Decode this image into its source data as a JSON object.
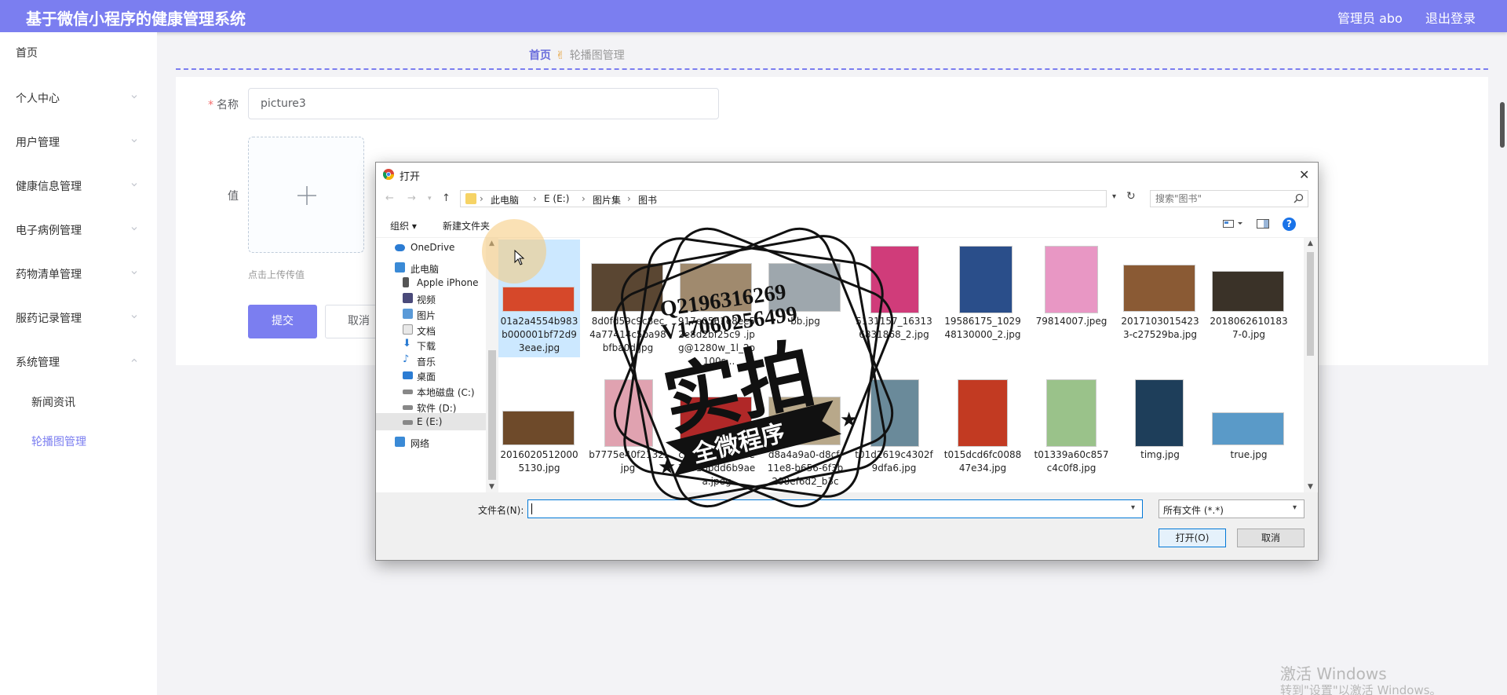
{
  "header": {
    "title": "基于微信小程序的健康管理系统",
    "user": "管理员 abo",
    "logout": "退出登录",
    "bg_color": "#7b7ef0"
  },
  "sidebar": {
    "items": [
      {
        "label": "首页"
      },
      {
        "label": "个人中心"
      },
      {
        "label": "用户管理"
      },
      {
        "label": "健康信息管理"
      },
      {
        "label": "电子病例管理"
      },
      {
        "label": "药物清单管理"
      },
      {
        "label": "服药记录管理"
      },
      {
        "label": "系统管理"
      },
      {
        "label": "新闻资讯"
      },
      {
        "label": "轮播图管理"
      }
    ]
  },
  "breadcrumb": {
    "home": "首页",
    "separator_icon": "hand-icon",
    "current": "轮播图管理"
  },
  "form": {
    "name_label": "名称",
    "name_value": "picture3",
    "value_label": "值",
    "upload_tip": "点击上传传值",
    "submit": "提交",
    "cancel": "取消"
  },
  "dialog": {
    "title": "打开",
    "address": [
      "此电脑",
      "E (E:)",
      "图片集",
      "图书"
    ],
    "search_placeholder": "搜索\"图书\"",
    "toolbar": {
      "organize": "组织 ▾",
      "new_folder": "新建文件夹",
      "help": "?"
    },
    "tree": [
      {
        "label": "OneDrive",
        "icon": "cloud-icon"
      },
      {
        "label": "此电脑",
        "icon": "computer-icon"
      },
      {
        "label": "Apple iPhone",
        "icon": "phone-icon"
      },
      {
        "label": "视频",
        "icon": "video-icon"
      },
      {
        "label": "图片",
        "icon": "picture-icon"
      },
      {
        "label": "文档",
        "icon": "document-icon"
      },
      {
        "label": "下载",
        "icon": "download-icon"
      },
      {
        "label": "音乐",
        "icon": "music-icon"
      },
      {
        "label": "桌面",
        "icon": "desktop-icon"
      },
      {
        "label": "本地磁盘 (C:)",
        "icon": "drive-icon"
      },
      {
        "label": "软件 (D:)",
        "icon": "drive-icon"
      },
      {
        "label": "E (E:)",
        "icon": "drive-icon"
      },
      {
        "label": "网络",
        "icon": "network-icon"
      }
    ],
    "files": [
      {
        "name": "01a2a4554b983b000001bf72d93eae.jpg",
        "color": "#d6482a"
      },
      {
        "name": "8d0fd59c9c8ec4a77414c5ba98bfba0d.jpg",
        "color": "#5a4632"
      },
      {
        "name": "917e0561e8ee52e8d2bf25c9 .jpg@1280w_1l_2o_100s...",
        "color": "#a08a6e"
      },
      {
        "name": "bb.jpg",
        "color": "#9ea7ad"
      },
      {
        "name": "5131157_163136831868_2.jpg",
        "color": "#d03c7a"
      },
      {
        "name": "19586175_102948130000_2.jpg",
        "color": "#2a4e8a"
      },
      {
        "name": "79814007.jpeg",
        "color": "#e897c4"
      },
      {
        "name": "20171030154233-c27529ba.jpg",
        "color": "#8a5a34"
      },
      {
        "name": "20180626101837-0.jpg",
        "color": "#3a3228"
      },
      {
        "name": "20160205120005130.jpg",
        "color": "#6e4a2a"
      },
      {
        "name": "b7775e40f2132.jpg",
        "color": "#e0a2b0"
      },
      {
        "name": "ccb1e9f7e2f63e3631bbdd6b9aea.jpeg",
        "color": "#b02828"
      },
      {
        "name": "d8a4a9a0-d8cf-11e8-b656-6f3b208ef6d2_b3c",
        "color": "#b8a88a"
      },
      {
        "name": "t01d2619c4302f9dfa6.jpg",
        "color": "#6a8a9a"
      },
      {
        "name": "t015dcd6fc008847e34.jpg",
        "color": "#c23a22"
      },
      {
        "name": "t01339a60c857c4c0f8.jpg",
        "color": "#9ac28a"
      },
      {
        "name": "timg.jpg",
        "color": "#1e3e5a"
      },
      {
        "name": "true.jpg",
        "color": "#5a9ac8"
      }
    ],
    "filename_label": "文件名(N):",
    "filename_value": "",
    "filter": "所有文件 (*.*)",
    "open": "打开(O)",
    "cancel": "取消"
  },
  "stamp": {
    "line1": "Q2196316269",
    "line2": "V17060256499",
    "big": "实拍",
    "ribbon": "全微程序"
  },
  "watermark": {
    "line1": "激活 Windows",
    "line2": "转到\"设置\"以激活 Windows。"
  }
}
